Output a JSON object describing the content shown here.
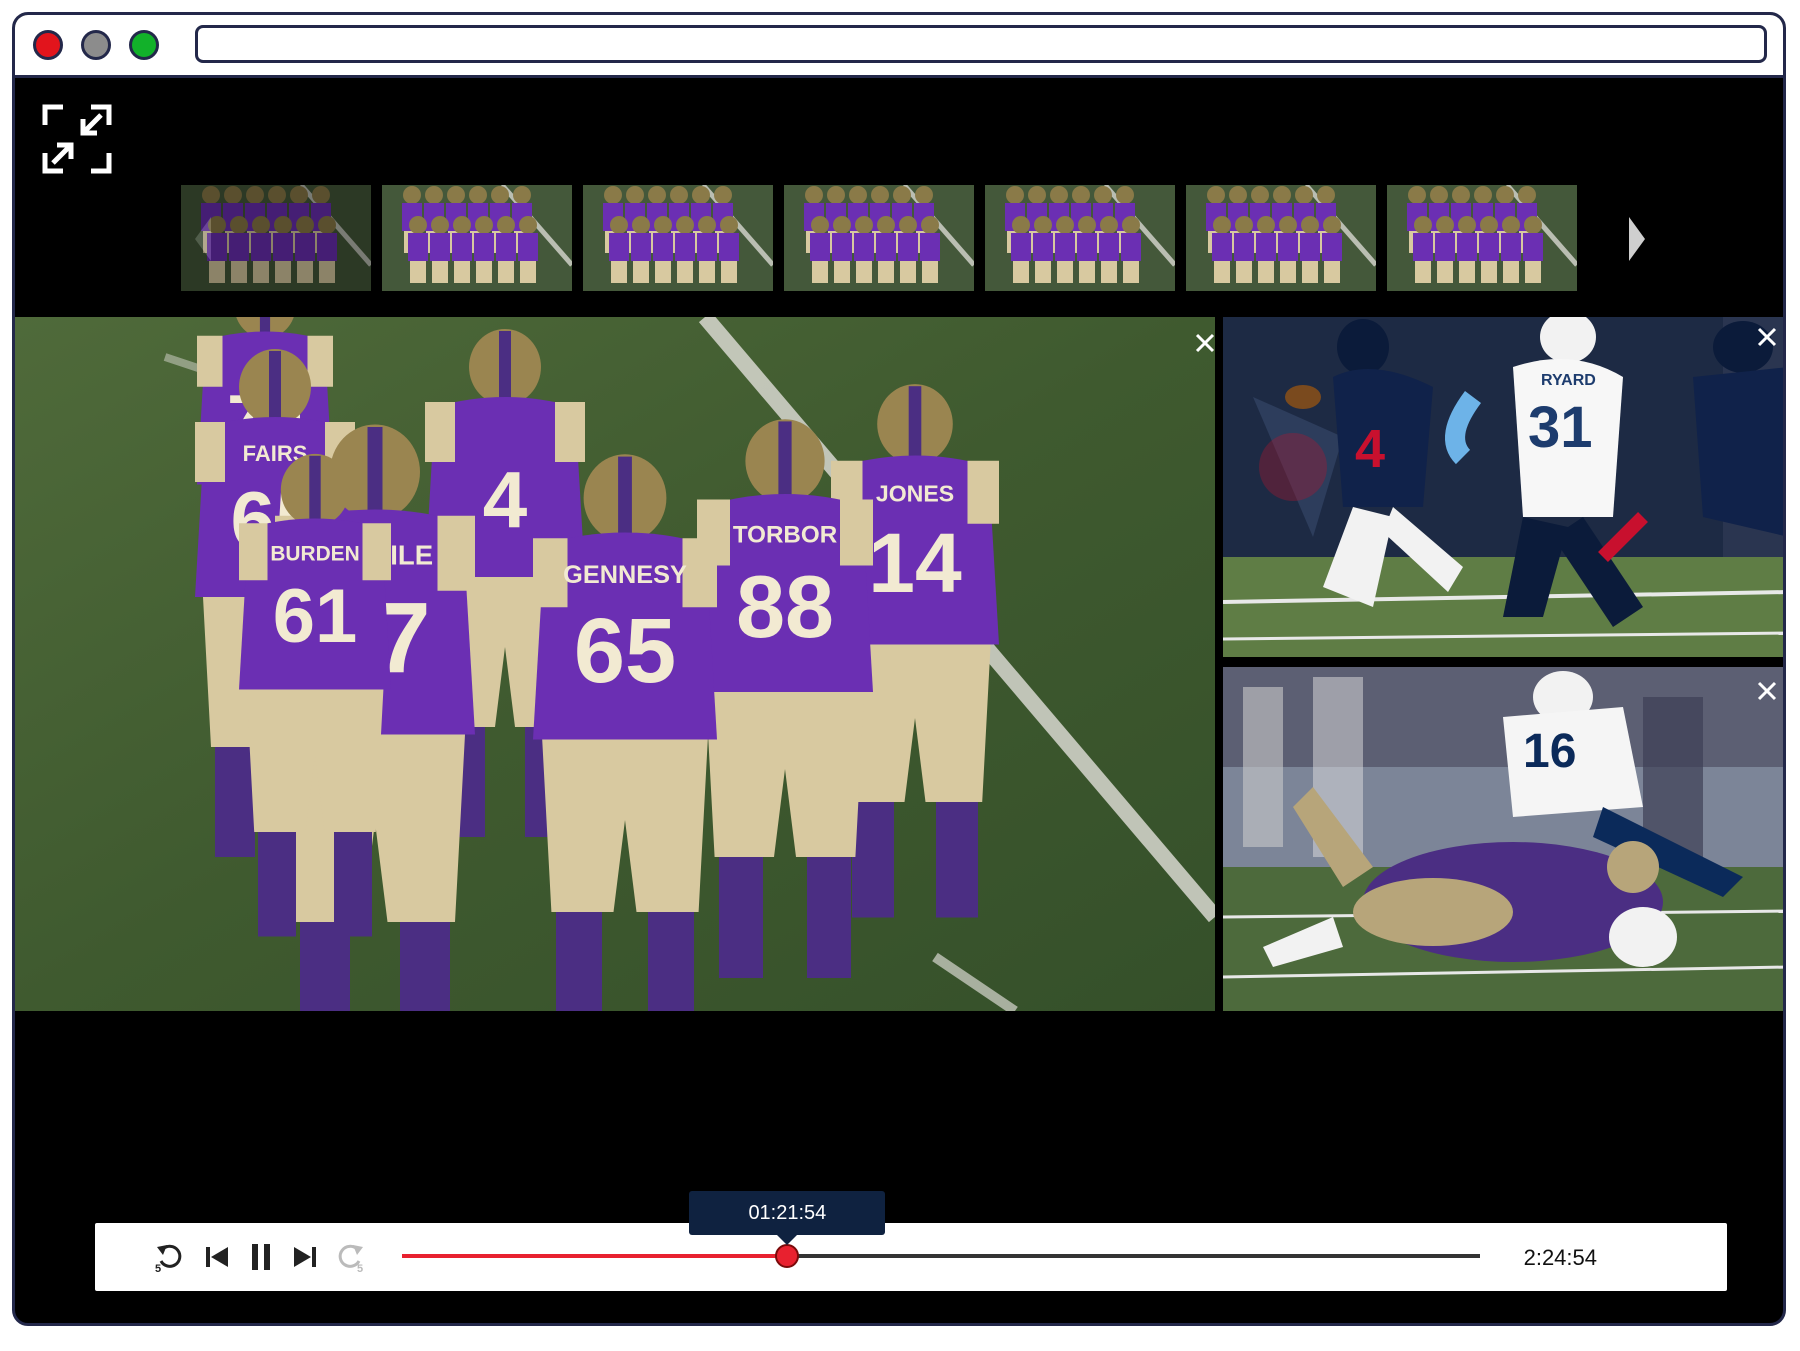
{
  "window": {
    "controls": [
      "close",
      "minimize",
      "maximize"
    ],
    "address_bar_value": ""
  },
  "player": {
    "fullscreen_icon": "exit-fullscreen-icon",
    "thumbnails": [
      {
        "label": ""
      },
      {
        "label": ""
      },
      {
        "label": ""
      },
      {
        "label": ""
      },
      {
        "label": ""
      },
      {
        "label": ""
      },
      {
        "label": ""
      }
    ],
    "main_feed": {
      "jerseys": [
        {
          "name": "PERTILE",
          "number": "77"
        },
        {
          "name": "GENNESY",
          "number": "65"
        },
        {
          "name": "TORBOR",
          "number": "88"
        },
        {
          "name": "JONES",
          "number": "14"
        },
        {
          "name": "FAIRS",
          "number": "65"
        },
        {
          "name": "BURDEN",
          "number": "61"
        },
        {
          "name": "",
          "number": "4"
        },
        {
          "name": "",
          "number": "70"
        }
      ]
    },
    "side_feed_1": {
      "jerseys": [
        {
          "name": "",
          "number": "4"
        },
        {
          "name": "RYARD",
          "number": "31"
        }
      ]
    },
    "side_feed_2": {
      "jerseys": [
        {
          "name": "",
          "number": "16"
        }
      ]
    },
    "close_icon": "close-icon"
  },
  "controls": {
    "current_time": "01:21:54",
    "duration": "2:24:54",
    "progress": 0.3575,
    "buttons": [
      "replay-5-icon",
      "skip-previous-icon",
      "pause-icon",
      "skip-next-icon",
      "forward-5-icon"
    ],
    "replay_label": "5",
    "forward_label": "5"
  },
  "colors": {
    "frame": "#23284a",
    "progress": "#e8212f",
    "tooltip": "#0f2240",
    "jersey_purple": "#6b2fb3",
    "helmet_gold": "#a08a50"
  }
}
